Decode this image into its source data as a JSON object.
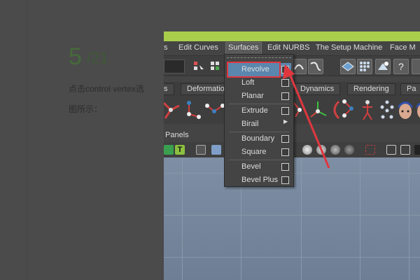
{
  "tutorial": {
    "step_current": "5",
    "step_total": "/21",
    "instruction_line1": "点击control vertex选",
    "instruction_line2": "图所示："
  },
  "menubar": {
    "items": [
      {
        "label": "s"
      },
      {
        "label": "Edit Curves"
      },
      {
        "label": "Surfaces"
      },
      {
        "label": "Edit NURBS"
      },
      {
        "label": "The Setup Machine"
      },
      {
        "label": "Face M"
      }
    ]
  },
  "shelf_tabs": [
    {
      "label": "s"
    },
    {
      "label": "Deformatio"
    },
    {
      "label": "Dynamics"
    },
    {
      "label": "Rendering"
    },
    {
      "label": "Pa"
    }
  ],
  "panels_menu": {
    "label": "Panels"
  },
  "surfaces_menu": {
    "items": [
      {
        "label": "Revolve",
        "option_box": true,
        "highlighted": true
      },
      {
        "label": "Loft",
        "option_box": true
      },
      {
        "label": "Planar",
        "option_box": true
      },
      {
        "label": "Extrude",
        "option_box": true
      },
      {
        "label": "Birail",
        "submenu": true
      },
      {
        "label": "Boundary",
        "option_box": true
      },
      {
        "label": "Square",
        "option_box": true
      },
      {
        "label": "Bevel",
        "option_box": true
      },
      {
        "label": "Bevel Plus",
        "option_box": true
      }
    ]
  },
  "colors": {
    "titlebar": "#a9ce4c",
    "highlight": "#5b86ad",
    "annotation_red": "#e0373f"
  },
  "icons": [
    "select-tool-icon",
    "snap-icon",
    "curve-icon",
    "nurbs-plane-icon",
    "cv-grid-icon",
    "render-icon",
    "help-icon",
    "joint-icon",
    "character-head-icon"
  ]
}
